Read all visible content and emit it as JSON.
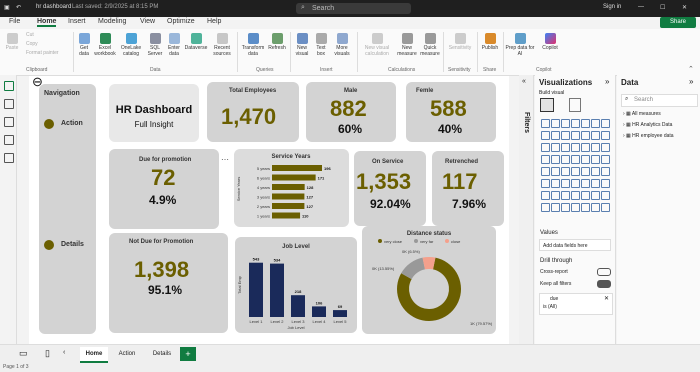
{
  "titlebar": {
    "file_name": "hr dashboard",
    "saved": "Last saved: 2/9/2025 at 8:15 PM",
    "search_placeholder": "Search",
    "sign_in": "Sign in"
  },
  "menu": {
    "items": [
      "File",
      "Home",
      "Insert",
      "Modeling",
      "View",
      "Optimize",
      "Help"
    ],
    "share": "Share"
  },
  "ribbon": {
    "clipboard": {
      "paste": "Paste",
      "cut": "Cut",
      "copy": "Copy",
      "format": "Format painter",
      "group": "Clipboard"
    },
    "data": {
      "get_data": "Get data",
      "excel": "Excel workbook",
      "onelake": "OneLake catalog",
      "sql": "SQL Server",
      "enter": "Enter data",
      "dataverse": "Dataverse",
      "recent": "Recent sources",
      "group": "Data"
    },
    "queries": {
      "transform": "Transform data",
      "refresh": "Refresh",
      "group": "Queries"
    },
    "insert": {
      "new_visual": "New visual",
      "text_box": "Text box",
      "more": "More visuals",
      "group": "Insert"
    },
    "calc": {
      "new_visual_calc": "New visual calculation",
      "new_measure": "New measure",
      "quick": "Quick measure",
      "group": "Calculations"
    },
    "sens": {
      "label": "Sensitivity",
      "group": "Sensitivity"
    },
    "share": {
      "publish": "Publish",
      "group": "Share"
    },
    "copilot": {
      "prep": "Prep data for AI",
      "copilot": "Copilot",
      "group": "Copilot"
    }
  },
  "navigation": {
    "title": "Navigation",
    "action": "Action",
    "details": "Details"
  },
  "dashboard": {
    "title": "HR Dashboard",
    "subtitle": "Full Insight"
  },
  "kpis": {
    "total_employees": {
      "label": "Total Employees",
      "value": "1,470"
    },
    "male": {
      "label": "Male",
      "value": "882",
      "pct": "60%"
    },
    "female": {
      "label": "Femle",
      "value": "588",
      "pct": "40%"
    },
    "due_promotion": {
      "label": "Due for promotion",
      "value": "72",
      "pct": "4.9%"
    },
    "not_due": {
      "label": "Not Due for Promotion",
      "value": "1,398",
      "pct": "95.1%"
    },
    "on_service": {
      "label": "On Service",
      "value": "1,353",
      "pct": "92.04%"
    },
    "retrenched": {
      "label": "Retrenched",
      "value": "117",
      "pct": "7.96%"
    }
  },
  "chart_data": [
    {
      "type": "bar",
      "title": "Service Years",
      "ylabel": "Service Years",
      "categories": [
        "5 years",
        "6 years",
        "4 years",
        "3 years",
        "2 years",
        "1 years"
      ],
      "values": [
        196,
        171,
        128,
        127,
        127,
        110
      ],
      "orientation": "horizontal"
    },
    {
      "type": "bar",
      "title": "Job Level",
      "xlabel": "Job Level",
      "ylabel": "Total Emp",
      "categories": [
        "Level 1",
        "Level 2",
        "Level 3",
        "Level 4",
        "Level 5"
      ],
      "values": [
        543,
        534,
        218,
        106,
        69
      ]
    },
    {
      "type": "pie",
      "title": "Distance status",
      "categories": [
        "very close",
        "very far",
        "close"
      ],
      "values": [
        80,
        13.55,
        6.45
      ],
      "slice_labels": [
        "1K (79.57%)",
        "0K (13.55%)",
        "0K (6.5%)"
      ],
      "colors": [
        "#6b5f00",
        "#999999",
        "#f4a08c"
      ]
    }
  ],
  "viz_pane": {
    "title": "Visualizations",
    "build": "Build visual",
    "values": "Values",
    "add_fields": "Add data fields here",
    "drill": "Drill through",
    "cross": "Cross-report",
    "keep": "Keep all filters",
    "filter_field": "due",
    "filter_val": "is (All)"
  },
  "data_pane": {
    "title": "Data",
    "search": "Search",
    "items": [
      "All measures",
      "HR Analytics Data",
      "HR employee data"
    ]
  },
  "filters_label": "Filters",
  "bottom": {
    "tabs": [
      "Home",
      "Action",
      "Details"
    ],
    "page": "Page 1 of 3"
  }
}
